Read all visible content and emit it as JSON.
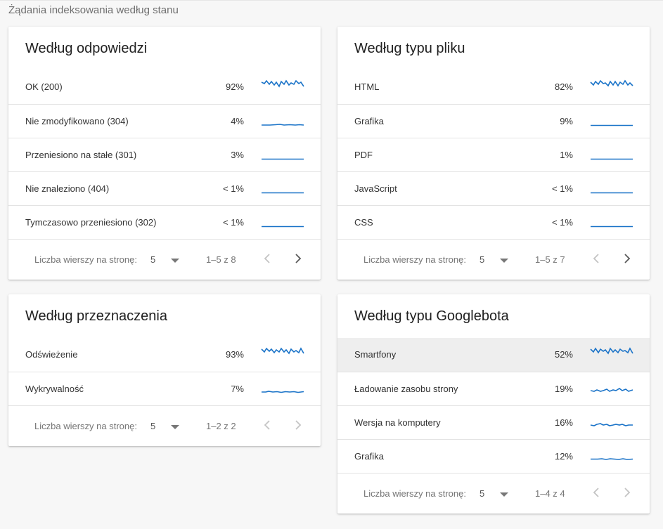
{
  "page": {
    "heading": "Żądania indeksowania według stanu"
  },
  "colors": {
    "accent": "#1a73c8",
    "chevron_disabled": "#c4c4c4",
    "chevron_enabled": "#5a5a5a"
  },
  "cards": {
    "response": {
      "title": "Według odpowiedzi",
      "rows": [
        {
          "label": "OK (200)",
          "value": "92%"
        },
        {
          "label": "Nie zmodyfikowano (304)",
          "value": "4%"
        },
        {
          "label": "Przeniesiono na stałe (301)",
          "value": "3%"
        },
        {
          "label": "Nie znaleziono (404)",
          "value": "< 1%"
        },
        {
          "label": "Tymczasowo przeniesiono (302)",
          "value": "< 1%"
        }
      ],
      "footer": {
        "rows_per_page_label": "Liczba wierszy na stronę:",
        "rows_per_page": "5",
        "range": "1–5 z 8",
        "prev_enabled": false,
        "next_enabled": true
      }
    },
    "filetype": {
      "title": "Według typu pliku",
      "rows": [
        {
          "label": "HTML",
          "value": "82%"
        },
        {
          "label": "Grafika",
          "value": "9%"
        },
        {
          "label": "PDF",
          "value": "1%"
        },
        {
          "label": "JavaScript",
          "value": "< 1%"
        },
        {
          "label": "CSS",
          "value": "< 1%"
        }
      ],
      "footer": {
        "rows_per_page_label": "Liczba wierszy na stronę:",
        "rows_per_page": "5",
        "range": "1–5 z 7",
        "prev_enabled": false,
        "next_enabled": true
      }
    },
    "purpose": {
      "title": "Według przeznaczenia",
      "rows": [
        {
          "label": "Odświeżenie",
          "value": "93%"
        },
        {
          "label": "Wykrywalność",
          "value": "7%"
        }
      ],
      "footer": {
        "rows_per_page_label": "Liczba wierszy na stronę:",
        "rows_per_page": "5",
        "range": "1–2 z 2",
        "prev_enabled": false,
        "next_enabled": false
      }
    },
    "googlebot": {
      "title": "Według typu Googlebota",
      "rows": [
        {
          "label": "Smartfony",
          "value": "52%"
        },
        {
          "label": "Ładowanie zasobu strony",
          "value": "19%"
        },
        {
          "label": "Wersja na komputery",
          "value": "16%"
        },
        {
          "label": "Grafika",
          "value": "12%"
        }
      ],
      "footer": {
        "rows_per_page_label": "Liczba wierszy na stronę:",
        "rows_per_page": "5",
        "range": "1–4 z 4",
        "prev_enabled": false,
        "next_enabled": false
      }
    }
  }
}
